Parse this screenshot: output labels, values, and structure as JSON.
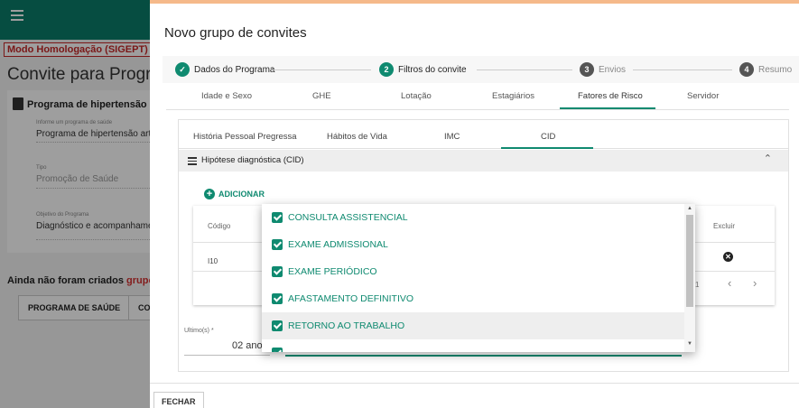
{
  "background": {
    "homolog_label": "Modo Homologação (SIGEPT)",
    "page_title": "Convite para Prograr",
    "card_title": "Programa de hipertensão arte",
    "fields": [
      {
        "label": "Informe um programa de saúde",
        "value": "Programa de hipertensão arte"
      },
      {
        "label": "Tipo",
        "value": "Promoção de Saúde"
      },
      {
        "label": "Objetivo do Programa",
        "value": "Diagnóstico e acompanhamen"
      }
    ],
    "warning_prefix": "Ainda não foram criados ",
    "warning_highlight": "grupo",
    "buttons": [
      "PROGRAMA DE SAÚDE",
      "CO"
    ]
  },
  "dialog": {
    "title": "Novo grupo de convites",
    "steps": [
      {
        "number": "✓",
        "label": "Dados do Programa",
        "state": "done"
      },
      {
        "number": "2",
        "label": "Filtros do convite",
        "state": "active"
      },
      {
        "number": "3",
        "label": "Envios",
        "state": "inactive"
      },
      {
        "number": "4",
        "label": "Resumo",
        "state": "inactive"
      }
    ],
    "tabs": [
      "Idade e Sexo",
      "GHE",
      "Lotação",
      "Estagiários",
      "Fatores de Risco",
      "Servidor"
    ],
    "active_tab": "Fatores de Risco",
    "subtabs": [
      "História Pessoal Pregressa",
      "Hábitos de Vida",
      "IMC",
      "CID"
    ],
    "active_subtab": "CID",
    "panel_title": "Hipótese diagnóstica (CID)",
    "add_label": "ADICIONAR",
    "table": {
      "col_codigo": "Código",
      "col_excluir": "Excluir",
      "rows": [
        {
          "codigo": "I10"
        }
      ],
      "pager_text": "1"
    },
    "ultimos": {
      "label": "Ultimo(s) *",
      "value": "02 ano"
    },
    "close_label": "FECHAR"
  },
  "dropdown": {
    "options": [
      {
        "label": "CONSULTA ASSISTENCIAL",
        "checked": true
      },
      {
        "label": "EXAME ADMISSIONAL",
        "checked": true
      },
      {
        "label": "EXAME PERIÓDICO",
        "checked": true
      },
      {
        "label": "AFASTAMENTO DEFINITIVO",
        "checked": true
      },
      {
        "label": "RETORNO AO TRABALHO",
        "checked": true
      }
    ]
  },
  "colors": {
    "accent": "#0f8a70",
    "topbar": "#0b7d6a",
    "warning": "#d32f2f"
  }
}
